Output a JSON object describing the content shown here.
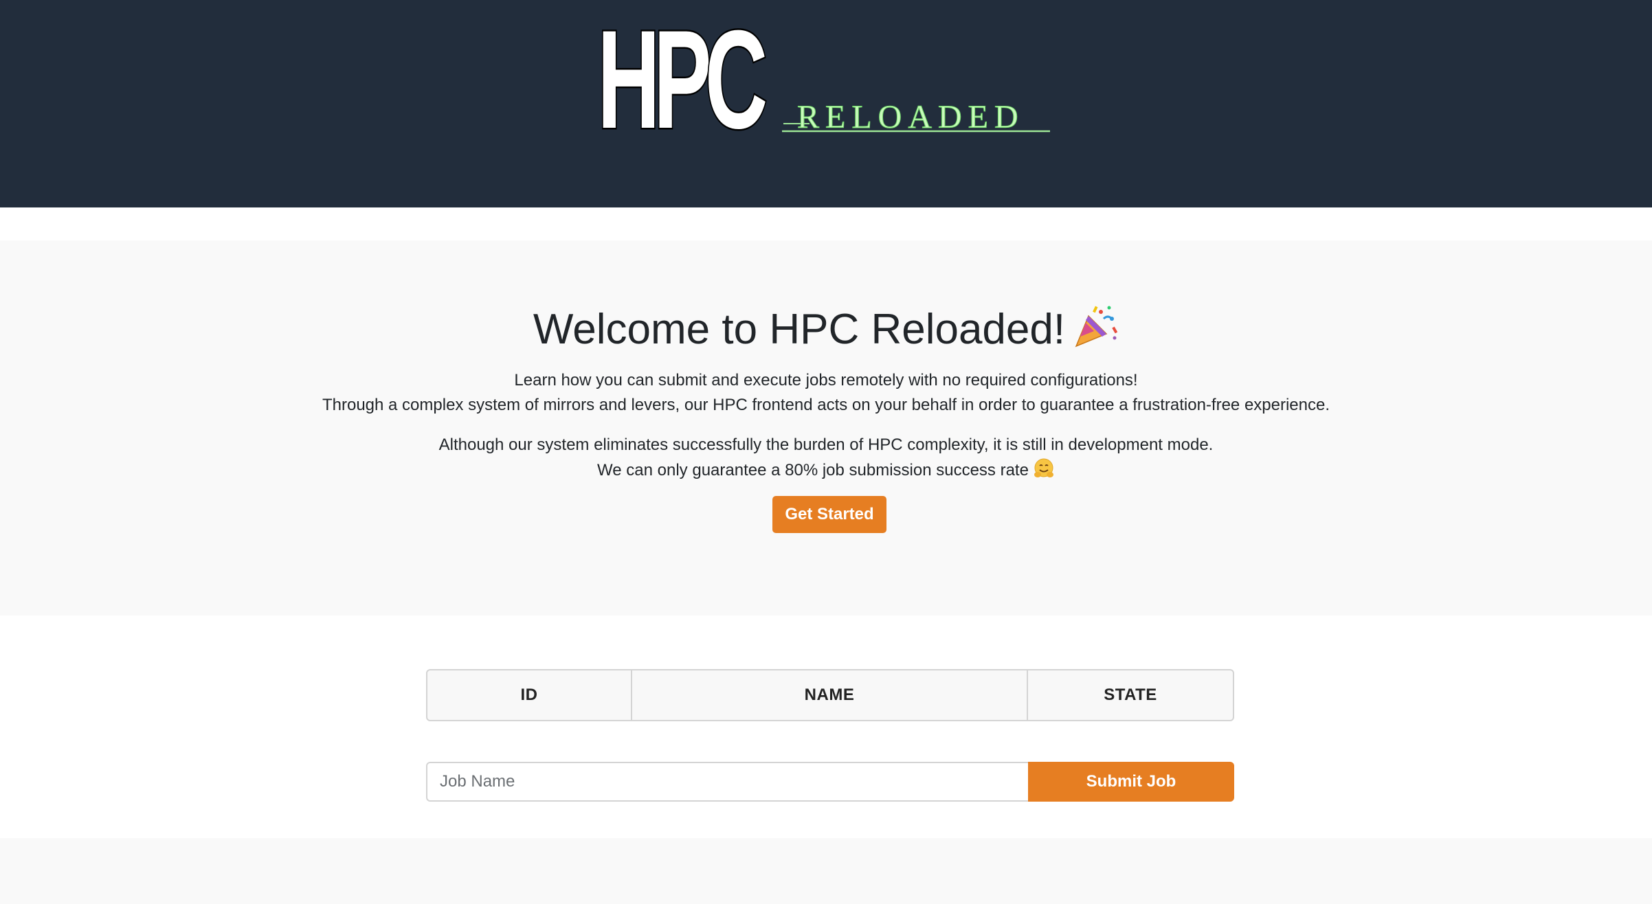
{
  "header": {
    "logo_main": "HPC",
    "logo_sub": "RELOADED"
  },
  "hero": {
    "title": "Welcome to HPC Reloaded!",
    "title_icon": "party-popper-icon",
    "line1": "Learn how you can submit and execute jobs remotely with no required configurations!",
    "line2": "Through a complex system of mirrors and levers, our HPC frontend acts on your behalf in order to guarantee a frustration-free experience.",
    "line3": "Although our system eliminates successfully the burden of HPC complexity, it is still in development mode.",
    "line4": "We can only guarantee a 80% job submission success rate",
    "line4_icon": "hugging-face-icon",
    "cta_label": "Get Started"
  },
  "jobs": {
    "columns": [
      "ID",
      "NAME",
      "STATE"
    ],
    "rows": []
  },
  "form": {
    "job_name_placeholder": "Job Name",
    "job_name_value": "",
    "submit_label": "Submit Job"
  },
  "colors": {
    "header_bg": "#222d3c",
    "accent": "#e67e22",
    "logo_sub": "#b6f5a8"
  }
}
